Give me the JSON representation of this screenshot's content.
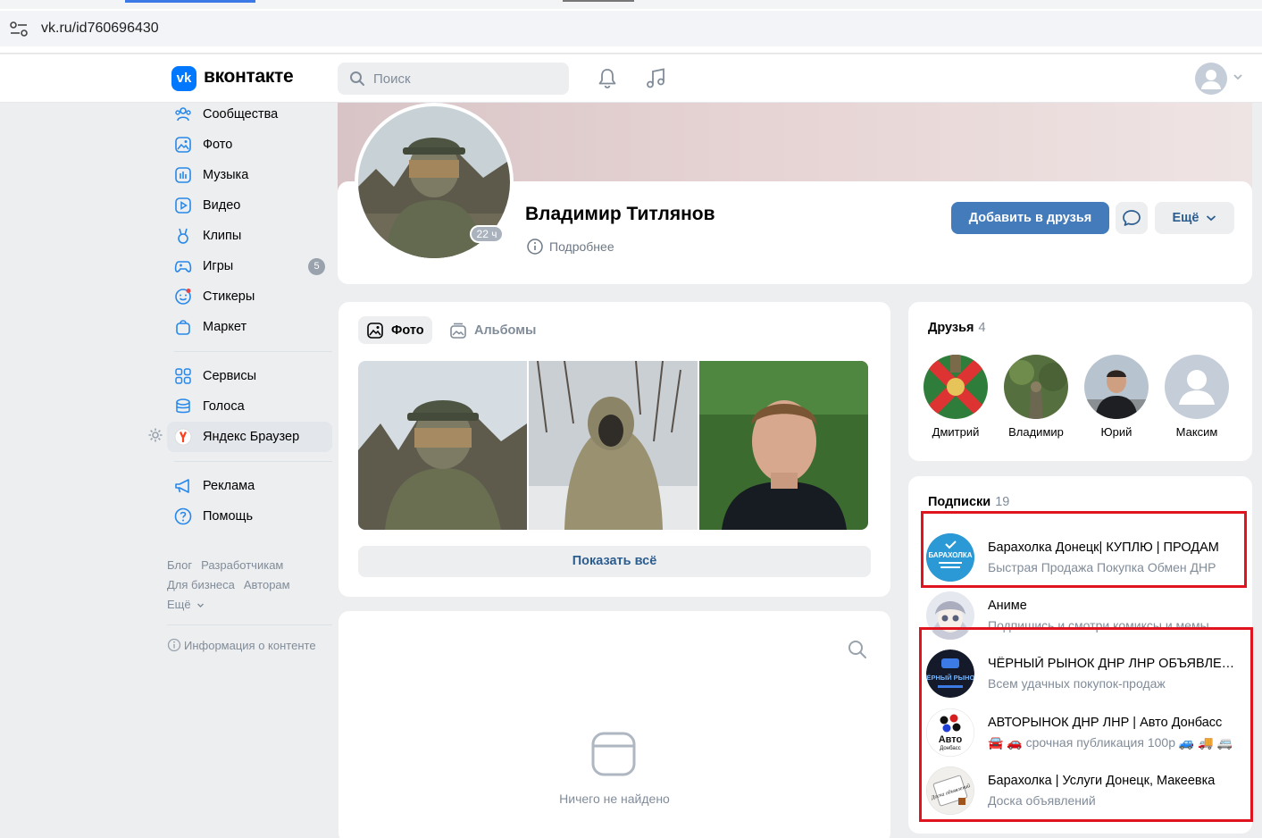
{
  "browser": {
    "url": "vk.ru/id760696430"
  },
  "header": {
    "logo_letters": "vk",
    "brand": "вконтакте",
    "search_placeholder": "Поиск"
  },
  "sidebar": {
    "items": [
      {
        "label": "Сообщества",
        "icon": "communities-icon"
      },
      {
        "label": "Фото",
        "icon": "photo-icon"
      },
      {
        "label": "Музыка",
        "icon": "music-icon"
      },
      {
        "label": "Видео",
        "icon": "video-icon"
      },
      {
        "label": "Клипы",
        "icon": "clips-icon"
      },
      {
        "label": "Игры",
        "icon": "games-icon",
        "badge": "5"
      },
      {
        "label": "Стикеры",
        "icon": "stickers-icon"
      },
      {
        "label": "Маркет",
        "icon": "market-icon"
      }
    ],
    "items2": [
      {
        "label": "Сервисы",
        "icon": "services-icon"
      },
      {
        "label": "Голоса",
        "icon": "votes-icon"
      },
      {
        "label": "Яндекс Браузер",
        "icon": "yandex-browser-icon"
      }
    ],
    "items3": [
      {
        "label": "Реклама",
        "icon": "ads-icon"
      },
      {
        "label": "Помощь",
        "icon": "help-icon"
      }
    ],
    "footer": {
      "blog": "Блог",
      "developers": "Разработчикам",
      "business": "Для бизнеса",
      "authors": "Авторам",
      "more": "Ещё",
      "content_info": "Информация о контенте"
    }
  },
  "profile": {
    "name": "Владимир Титлянов",
    "last_seen": "22 ч",
    "details": "Подробнее",
    "add_friend": "Добавить в друзья",
    "more": "Ещё"
  },
  "photos": {
    "tab_photos": "Фото",
    "tab_albums": "Альбомы",
    "show_all": "Показать всё"
  },
  "wall": {
    "empty": "Ничего не найдено"
  },
  "friends": {
    "title": "Друзья",
    "count": "4",
    "list": [
      {
        "name": "Дмитрий"
      },
      {
        "name": "Владимир"
      },
      {
        "name": "Юрий"
      },
      {
        "name": "Максим"
      }
    ]
  },
  "subscriptions": {
    "title": "Подписки",
    "count": "19",
    "list": [
      {
        "title": "Барахолка Донецк| КУПЛЮ | ПРОДАМ",
        "subtitle": "Быстрая Продажа Покупка Обмен ДНР",
        "logo_text": "БАРАХОЛКА"
      },
      {
        "title": "Аниме",
        "subtitle": "Подпишись и смотри комиксы и мемы"
      },
      {
        "title": "ЧЁРНЫЙ РЫНОК ДНР ЛНР ОБЪЯВЛЕНИЯ",
        "subtitle": "Всем удачных покупок-продаж",
        "logo_text": "ЧЁРНЫЙ РЫНОК"
      },
      {
        "title": "АВТОРЫНОК ДНР ЛНР | Авто Донбасс",
        "subtitle": "🚘 🚗 срочная публикация 100р 🚙 🚚 🚐",
        "logo_text": "Авто",
        "logo_sub": "Донбасс"
      },
      {
        "title": "Барахолка | Услуги Донецк, Макеевка",
        "subtitle": "Доска объявлений",
        "logo_text": "Доска объявлений"
      }
    ]
  },
  "colors": {
    "accent": "#447bba",
    "vk_blue": "#0077ff",
    "highlight": "#e0141e"
  }
}
